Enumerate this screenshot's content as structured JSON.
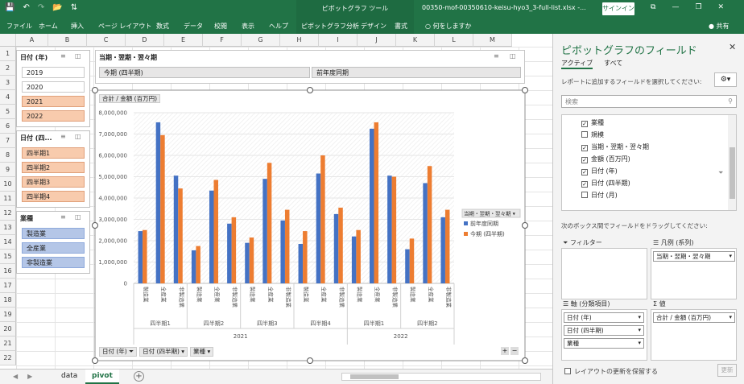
{
  "titlebar": {
    "qat_icons": [
      "save-icon",
      "undo-icon",
      "redo-icon",
      "open-icon",
      "sort-icon"
    ],
    "context_title": "ピボットグラフ ツール",
    "filename": "00350-mof-00350610-keisu-hyo3_3-full-list.xlsx -...",
    "signin": "サインイン",
    "window_buttons": [
      "⧉",
      "—",
      "❐",
      "✕"
    ]
  },
  "ribbon": {
    "tabs": [
      "ファイル",
      "ホーム",
      "挿入",
      "ページ レイアウト",
      "数式",
      "データ",
      "校閲",
      "表示",
      "ヘルプ",
      "ピボットグラフ分析",
      "デザイン",
      "書式"
    ],
    "tell_me": "何をしますか",
    "share": "共有"
  },
  "sheet": {
    "columns": [
      "A",
      "B",
      "C",
      "D",
      "E",
      "F",
      "G",
      "H",
      "I",
      "J",
      "K",
      "L",
      "M"
    ],
    "rows": [
      "1",
      "2",
      "3",
      "4",
      "5",
      "6",
      "7",
      "8",
      "9",
      "10",
      "11",
      "12",
      "13",
      "14",
      "15",
      "16",
      "17",
      "18",
      "19",
      "20",
      "21",
      "22"
    ]
  },
  "slicers": {
    "year": {
      "title": "日付 (年)",
      "items": [
        "2019",
        "2020",
        "2021",
        "2022"
      ],
      "selected": [
        false,
        false,
        true,
        true
      ]
    },
    "quarter": {
      "title": "日付 (四...",
      "items": [
        "四半期1",
        "四半期2",
        "四半期3",
        "四半期4"
      ]
    },
    "industry": {
      "title": "業種",
      "items": [
        "製造業",
        "全産業",
        "非製造業"
      ]
    }
  },
  "chart": {
    "filter_box_title": "当期・翌期・翌々期",
    "filter_items": [
      "今期 (四半期)",
      "前年度同期"
    ],
    "value_field": "合計 / 金額 (百万円)",
    "legend_title": "当期・翌期・翌々期",
    "axis_buttons": [
      "日付 (年)",
      "日付 (四半期)",
      "業種"
    ],
    "zoom": [
      "+",
      "−"
    ]
  },
  "chart_data": {
    "type": "bar",
    "ylim": [
      0,
      8000000
    ],
    "yticks": [
      "8,000,000",
      "7,000,000",
      "6,000,000",
      "5,000,000",
      "4,000,000",
      "3,000,000",
      "2,000,000",
      "1,000,000",
      "0"
    ],
    "categories": [
      "製造業",
      "全産業",
      "非製造業",
      "製造業",
      "全産業",
      "非製造業",
      "製造業",
      "全産業",
      "非製造業",
      "製造業",
      "全産業",
      "非製造業",
      "製造業",
      "全産業",
      "非製造業",
      "製造業",
      "全産業",
      "非製造業"
    ],
    "quarters": [
      "四半期1",
      "四半期2",
      "四半期3",
      "四半期4",
      "四半期1",
      "四半期2"
    ],
    "years": [
      "2021",
      "2022"
    ],
    "series": [
      {
        "name": "前年度同期",
        "color": "#4472c4",
        "values": [
          2450000,
          7550000,
          5050000,
          1550000,
          4350000,
          2800000,
          1900000,
          4900000,
          2950000,
          1850000,
          5150000,
          3250000,
          2200000,
          7250000,
          5050000,
          1600000,
          4700000,
          3100000
        ]
      },
      {
        "name": "今期 (四半期)",
        "color": "#ed7d31",
        "values": [
          2500000,
          6950000,
          4450000,
          1750000,
          4850000,
          3100000,
          2150000,
          5650000,
          3450000,
          2450000,
          6000000,
          3550000,
          2500000,
          7550000,
          5000000,
          2100000,
          5500000,
          3450000
        ]
      }
    ]
  },
  "pane": {
    "title": "ピボットグラフのフィールド",
    "tabs": [
      "アクティブ",
      "すべて"
    ],
    "desc": "レポートに追加するフィールドを選択してください:",
    "search_placeholder": "検索",
    "fields": [
      {
        "label": "業種",
        "checked": true
      },
      {
        "label": "規模",
        "checked": false
      },
      {
        "label": "当期・翌期・翌々期",
        "checked": true
      },
      {
        "label": "金額 (百万円)",
        "checked": true
      },
      {
        "label": "日付 (年)",
        "checked": true
      },
      {
        "label": "日付 (四半期)",
        "checked": true
      },
      {
        "label": "日付 (月)",
        "checked": false
      }
    ],
    "drag_text": "次のボックス間でフィールドをドラッグしてください:",
    "areas": {
      "filter": {
        "label": "フィルター",
        "items": []
      },
      "legend": {
        "label": "凡例 (系列)",
        "items": [
          "当期・翌期・翌々期"
        ]
      },
      "axis": {
        "label": "軸 (分類項目)",
        "items": [
          "日付 (年)",
          "日付 (四半期)",
          "業種"
        ]
      },
      "values": {
        "label": "値",
        "items": [
          "合計 / 金額 (百万円)"
        ]
      }
    },
    "defer_label": "レイアウトの更新を保留する",
    "update_label": "更新"
  },
  "sheettabs": {
    "tabs": [
      "data",
      "pivot"
    ],
    "active": "pivot"
  }
}
